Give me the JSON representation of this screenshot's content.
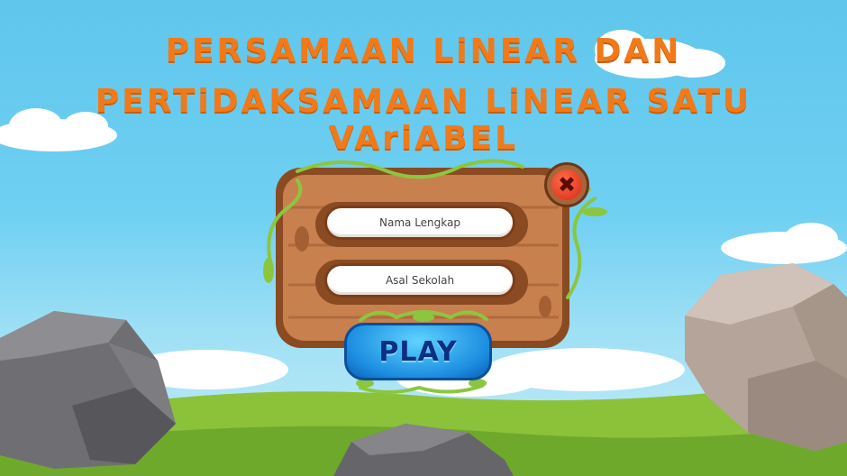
{
  "title": {
    "line1": "PERSAMAAN LiNEAR DAN",
    "line2": "PERTiDAKSAMAAN LiNEAR SATU VAriABEL"
  },
  "form": {
    "name_placeholder": "Nama Lengkap",
    "school_placeholder": "Asal Sekolah"
  },
  "buttons": {
    "play_label": "PLAY",
    "close_glyph": "✖"
  },
  "colors": {
    "title": "#f07a1a",
    "sky": "#5fc6ec",
    "grass": "#8bc23a",
    "wood": "#c8804f",
    "play": "#1c8de0",
    "close": "#d62b12"
  }
}
